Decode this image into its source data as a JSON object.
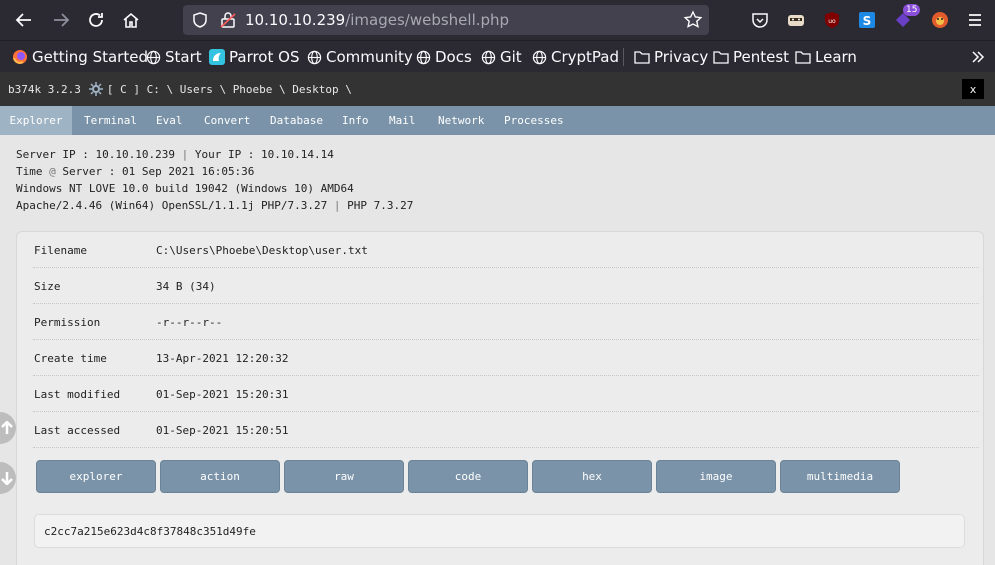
{
  "browser": {
    "url_host": "10.10.10.239",
    "url_path": "/images/webshell.php",
    "extension_badge": "15"
  },
  "bookmarks": [
    {
      "label": "Getting Started",
      "icon": "firefox-icon"
    },
    {
      "label": "Start",
      "icon": "globe-icon"
    },
    {
      "label": "Parrot OS",
      "icon": "parrot-icon"
    },
    {
      "label": "Community",
      "icon": "globe-icon"
    },
    {
      "label": "Docs",
      "icon": "globe-icon"
    },
    {
      "label": "Git",
      "icon": "globe-icon"
    },
    {
      "label": "CryptPad",
      "icon": "globe-icon"
    },
    {
      "label": "Privacy",
      "icon": "folder-icon"
    },
    {
      "label": "Pentest",
      "icon": "folder-icon"
    },
    {
      "label": "Learn",
      "icon": "folder-icon"
    }
  ],
  "shell": {
    "version": "b374k 3.2.3",
    "path": "[ C ] C: \\ Users \\ Phoebe \\ Desktop \\",
    "close_label": "x"
  },
  "menu": [
    {
      "label": "Explorer",
      "active": true
    },
    {
      "label": "Terminal"
    },
    {
      "label": "Eval"
    },
    {
      "label": "Convert"
    },
    {
      "label": "Database"
    },
    {
      "label": "Info"
    },
    {
      "label": "Mail"
    },
    {
      "label": "Network"
    },
    {
      "label": "Processes"
    }
  ],
  "info": {
    "server_ip_label": "Server IP : 10.10.10.239",
    "your_ip_label": "Your IP : 10.10.14.14",
    "time_prefix": "Time",
    "at": "@",
    "time_value": "Server : 01 Sep 2021 16:05:36",
    "os": "Windows NT LOVE 10.0 build 19042 (Windows 10) AMD64",
    "apache": "Apache/2.4.46 (Win64) OpenSSL/1.1.1j PHP/7.3.27",
    "php": "PHP 7.3.27",
    "sep": "|"
  },
  "file": {
    "rows": [
      {
        "key": "Filename",
        "value": "C:\\Users\\Phoebe\\Desktop\\user.txt"
      },
      {
        "key": "Size",
        "value": "34 B (34)"
      },
      {
        "key": "Permission",
        "value": "-r--r--r--"
      },
      {
        "key": "Create time",
        "value": "13-Apr-2021 12:20:32"
      },
      {
        "key": "Last modified",
        "value": "01-Sep-2021 15:20:31"
      },
      {
        "key": "Last accessed",
        "value": "01-Sep-2021 15:20:51"
      }
    ],
    "actions": [
      "explorer",
      "action",
      "raw",
      "code",
      "hex",
      "image",
      "multimedia"
    ],
    "content": "c2cc7a215e623d4c8f37848c351d49fe"
  }
}
